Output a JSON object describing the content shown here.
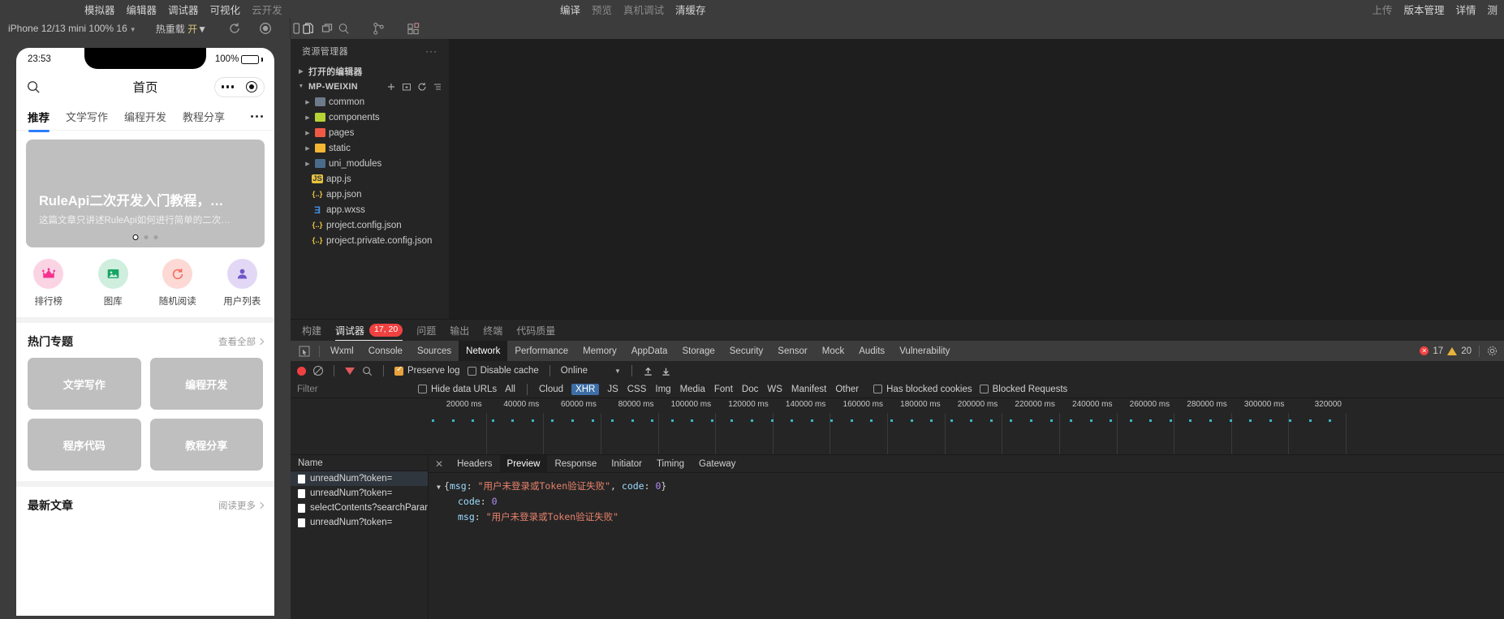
{
  "topbar": {
    "left_items": [
      "模拟器",
      "编辑器",
      "调试器",
      "可视化",
      "云开发"
    ],
    "left_dim_index": 4,
    "center_items": [
      "编译",
      "预览",
      "真机调试",
      "清缓存"
    ],
    "center_dim": [
      "预览",
      "真机调试"
    ],
    "right_items": [
      "上传",
      "版本管理",
      "详情",
      "测"
    ]
  },
  "sim_toolbar": {
    "device": "iPhone 12/13 mini 100% 16",
    "hot_reload_label": "热重载",
    "hot_reload_value": "开",
    "icons": [
      "refresh-icon",
      "stop-icon",
      "phone-icon",
      "multiwindow-icon"
    ]
  },
  "editor_toolbar": {
    "icons": [
      "files-icon",
      "search-icon",
      "source-control-icon",
      "extensions-icon"
    ]
  },
  "phone": {
    "status": {
      "time": "23:53",
      "battery": "100%"
    },
    "nav": {
      "title": "首页",
      "search_icon": "search-icon"
    },
    "tabs": [
      {
        "label": "推荐",
        "active": true
      },
      {
        "label": "文学写作",
        "active": false
      },
      {
        "label": "编程开发",
        "active": false
      },
      {
        "label": "教程分享",
        "active": false
      }
    ],
    "banner": {
      "title": "RuleApi二次开发入门教程，…",
      "subtitle": "这篇文章只讲述RuleApi如何进行简单的二次…",
      "pages": 3,
      "active_page": 0
    },
    "quick_actions": [
      {
        "label": "排行榜",
        "icon": "crown-icon",
        "bg": "#fbd4e4",
        "fg": "#f7308f"
      },
      {
        "label": "图库",
        "icon": "image-icon",
        "bg": "#cfeede",
        "fg": "#18a464"
      },
      {
        "label": "随机阅读",
        "icon": "refresh-circle-icon",
        "bg": "#fcd9d5",
        "fg": "#f4685c"
      },
      {
        "label": "用户列表",
        "icon": "user-icon",
        "bg": "#e2d8f6",
        "fg": "#6f58c9"
      }
    ],
    "hot_section": {
      "title": "热门专题",
      "more": "查看全部"
    },
    "topics": [
      "文学写作",
      "编程开发",
      "程序代码",
      "教程分享"
    ],
    "latest_section": {
      "title": "最新文章",
      "more": "阅读更多"
    }
  },
  "explorer": {
    "header": "资源管理器",
    "open_editors": "打开的编辑器",
    "project": "MP-WEIXIN",
    "action_icons": [
      "new-file-icon",
      "new-folder-icon",
      "refresh-icon",
      "collapse-icon"
    ],
    "items": [
      {
        "name": "common",
        "type": "folder",
        "color": "#6c7a89"
      },
      {
        "name": "components",
        "type": "folder",
        "color": "#b5d334"
      },
      {
        "name": "pages",
        "type": "folder",
        "color": "#f05a45"
      },
      {
        "name": "static",
        "type": "folder",
        "color": "#f2b632"
      },
      {
        "name": "uni_modules",
        "type": "folder",
        "color": "#4a6b8a"
      },
      {
        "name": "app.js",
        "type": "file",
        "glyph": "JS",
        "color": "#e8c33d"
      },
      {
        "name": "app.json",
        "type": "file",
        "glyph": "{..}",
        "color": "#e8c33d"
      },
      {
        "name": "app.wxss",
        "type": "file",
        "glyph": "Ǝ",
        "color": "#3f8fe0"
      },
      {
        "name": "project.config.json",
        "type": "file",
        "glyph": "{..}",
        "color": "#e8c33d"
      },
      {
        "name": "project.private.config.json",
        "type": "file",
        "glyph": "{..}",
        "color": "#e8c33d"
      }
    ]
  },
  "devtools": {
    "outer_tabs": [
      {
        "label": "构建",
        "active": false
      },
      {
        "label": "调试器",
        "active": true,
        "badge": "17, 20"
      },
      {
        "label": "问题",
        "active": false
      },
      {
        "label": "输出",
        "active": false
      },
      {
        "label": "终端",
        "active": false
      },
      {
        "label": "代码质量",
        "active": false
      }
    ],
    "panel_tabs": [
      "Wxml",
      "Console",
      "Sources",
      "Network",
      "Performance",
      "Memory",
      "AppData",
      "Storage",
      "Security",
      "Sensor",
      "Mock",
      "Audits",
      "Vulnerability"
    ],
    "panel_active": "Network",
    "counts": {
      "errors": "17",
      "warnings": "20"
    },
    "network_toolbar": {
      "preserve_log": "Preserve log",
      "preserve_log_checked": true,
      "disable_cache": "Disable cache",
      "disable_cache_checked": false,
      "throttle": "Online"
    },
    "filter_row": {
      "placeholder": "Filter",
      "hide_data_urls": "Hide data URLs",
      "types": [
        "All",
        "Cloud",
        "XHR",
        "JS",
        "CSS",
        "Img",
        "Media",
        "Font",
        "Doc",
        "WS",
        "Manifest",
        "Other"
      ],
      "active_type": "XHR",
      "has_blocked_cookies": "Has blocked cookies",
      "blocked_requests": "Blocked Requests"
    },
    "timeline": {
      "ticks": [
        "20000 ms",
        "40000 ms",
        "60000 ms",
        "80000 ms",
        "100000 ms",
        "120000 ms",
        "140000 ms",
        "160000 ms",
        "180000 ms",
        "200000 ms",
        "220000 ms",
        "240000 ms",
        "260000 ms",
        "280000 ms",
        "300000 ms",
        "320000"
      ]
    },
    "requests": {
      "column": "Name",
      "rows": [
        {
          "name": "unreadNum?token=",
          "selected": true
        },
        {
          "name": "unreadNum?token=",
          "selected": false
        },
        {
          "name": "selectContents?searchParams..",
          "selected": false
        },
        {
          "name": "unreadNum?token=",
          "selected": false
        }
      ]
    },
    "detail_tabs": [
      "Headers",
      "Preview",
      "Response",
      "Initiator",
      "Timing",
      "Gateway"
    ],
    "detail_active": "Preview",
    "preview": {
      "summary_prefix": "{",
      "summary_key1": "msg",
      "summary_val1": "\"用户未登录或Token验证失败\"",
      "summary_key2": "code",
      "summary_val2": "0",
      "summary_suffix": "}",
      "row1_key": "code",
      "row1_val": "0",
      "row2_key": "msg",
      "row2_val": "\"用户未登录或Token验证失败\""
    }
  }
}
